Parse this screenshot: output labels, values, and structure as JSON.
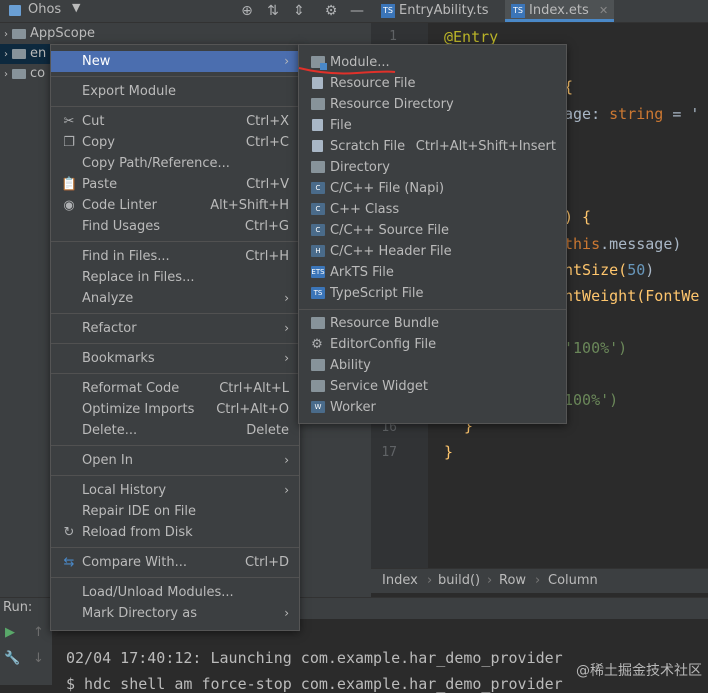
{
  "project": {
    "title": "Ohos",
    "tree": [
      {
        "label": "AppScope"
      },
      {
        "label": "en"
      },
      {
        "label": "co"
      }
    ]
  },
  "editor": {
    "tabs": [
      {
        "label": "EntryAbility.ts",
        "badge": "TS"
      },
      {
        "label": "Index.ets",
        "badge": "TS"
      }
    ],
    "code": {
      "line1_num": "1",
      "line1_text": "@Entry",
      "line3_brace": "{",
      "line4_a": "age: ",
      "line4_b": "string",
      "line4_c": " = '",
      "line7_a": ") {",
      "line8_a": "this",
      "line8_b": ".message)",
      "line9_a": "ntSize(",
      "line9_b": "50",
      "line9_c": ")",
      "line10_a": "ntWeight(FontWe",
      "line12_a": "'100%')",
      "line14_a": "100%')",
      "line16_num": "16",
      "line16_text": "}",
      "line17_num": "17",
      "line17_text": "}"
    },
    "breadcrumb": [
      "Index",
      "build()",
      "Row",
      "Column"
    ]
  },
  "run": {
    "label": "Run:",
    "console": [
      "02/04 17:40:12: Launching com.example.har_demo_provider",
      "$ hdc shell am force-stop com.example.har_demo_provider"
    ]
  },
  "watermark": "@稀土掘金技术社区",
  "context_menu": {
    "items": [
      {
        "label": "New",
        "arrow": "›"
      },
      {
        "label": "Export Module"
      },
      {
        "label": "Cut",
        "shortcut": "Ctrl+X"
      },
      {
        "label": "Copy",
        "shortcut": "Ctrl+C"
      },
      {
        "label": "Copy Path/Reference..."
      },
      {
        "label": "Paste",
        "shortcut": "Ctrl+V"
      },
      {
        "label": "Code Linter",
        "shortcut": "Alt+Shift+H"
      },
      {
        "label": "Find Usages",
        "shortcut": "Ctrl+G"
      },
      {
        "label": "Find in Files...",
        "shortcut": "Ctrl+H"
      },
      {
        "label": "Replace in Files..."
      },
      {
        "label": "Analyze",
        "arrow": "›"
      },
      {
        "label": "Refactor",
        "arrow": "›"
      },
      {
        "label": "Bookmarks",
        "arrow": "›"
      },
      {
        "label": "Reformat Code",
        "shortcut": "Ctrl+Alt+L"
      },
      {
        "label": "Optimize Imports",
        "shortcut": "Ctrl+Alt+O"
      },
      {
        "label": "Delete...",
        "shortcut": "Delete"
      },
      {
        "label": "Open In",
        "arrow": "›"
      },
      {
        "label": "Local History",
        "arrow": "›"
      },
      {
        "label": "Repair IDE on File"
      },
      {
        "label": "Reload from Disk"
      },
      {
        "label": "Compare With...",
        "shortcut": "Ctrl+D"
      },
      {
        "label": "Load/Unload Modules..."
      },
      {
        "label": "Mark Directory as",
        "arrow": "›"
      }
    ]
  },
  "submenu": {
    "items": [
      {
        "label": "Module..."
      },
      {
        "label": "Resource File"
      },
      {
        "label": "Resource Directory"
      },
      {
        "label": "File"
      },
      {
        "label": "Scratch File",
        "shortcut": "Ctrl+Alt+Shift+Insert"
      },
      {
        "label": "Directory"
      },
      {
        "label": "C/C++ File (Napi)"
      },
      {
        "label": "C++ Class"
      },
      {
        "label": "C/C++ Source File"
      },
      {
        "label": "C/C++ Header File"
      },
      {
        "label": "ArkTS File"
      },
      {
        "label": "TypeScript File"
      },
      {
        "label": "Resource Bundle"
      },
      {
        "label": "EditorConfig File"
      },
      {
        "label": "Ability"
      },
      {
        "label": "Service Widget"
      },
      {
        "label": "Worker"
      }
    ]
  },
  "colors": {
    "highlight": "#4b6eaf",
    "menu_bg": "#3c3f41",
    "annotation_red": "#e0312a"
  }
}
